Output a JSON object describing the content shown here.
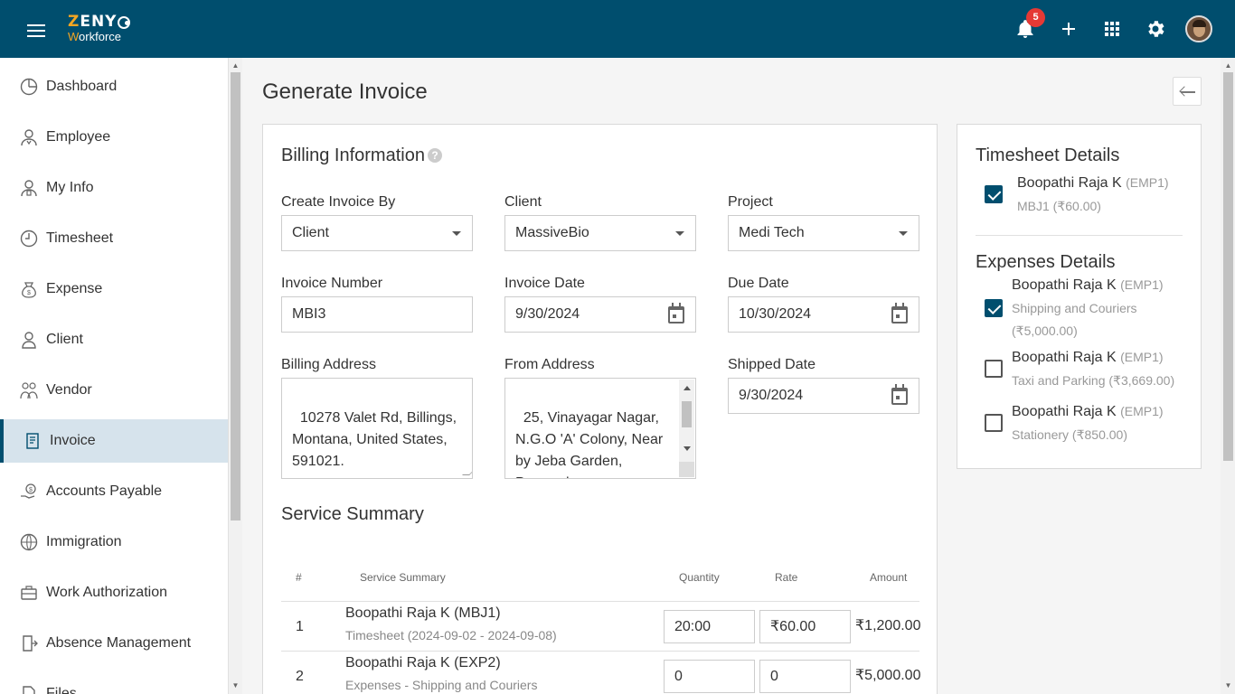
{
  "app": {
    "logo_main": "ZENY",
    "logo_sub": "Workforce"
  },
  "header": {
    "notification_count": "5"
  },
  "sidebar": {
    "items": [
      {
        "label": "Dashboard",
        "icon": "dashboard-icon"
      },
      {
        "label": "Employee",
        "icon": "employee-icon"
      },
      {
        "label": "My Info",
        "icon": "my-info-icon"
      },
      {
        "label": "Timesheet",
        "icon": "timesheet-icon"
      },
      {
        "label": "Expense",
        "icon": "expense-icon"
      },
      {
        "label": "Client",
        "icon": "client-icon"
      },
      {
        "label": "Vendor",
        "icon": "vendor-icon"
      },
      {
        "label": "Invoice",
        "icon": "invoice-icon",
        "active": true
      },
      {
        "label": "Accounts Payable",
        "icon": "accounts-payable-icon"
      },
      {
        "label": "Immigration",
        "icon": "immigration-icon"
      },
      {
        "label": "Work Authorization",
        "icon": "work-authorization-icon"
      },
      {
        "label": "Absence Management",
        "icon": "absence-management-icon"
      },
      {
        "label": "Files",
        "icon": "files-icon"
      }
    ]
  },
  "page": {
    "title": "Generate Invoice"
  },
  "billing": {
    "title": "Billing Information",
    "create_by_label": "Create Invoice By",
    "create_by_value": "Client",
    "client_label": "Client",
    "client_value": "MassiveBio",
    "project_label": "Project",
    "project_value": "Medi Tech",
    "invoice_number_label": "Invoice Number",
    "invoice_number_value": "MBI3",
    "invoice_date_label": "Invoice Date",
    "invoice_date_value": "9/30/2024",
    "due_date_label": "Due Date",
    "due_date_value": "10/30/2024",
    "billing_address_label": "Billing Address",
    "billing_address_value": "10278 Valet Rd, Billings,\nMontana, United States,\n591021.",
    "from_address_label": "From Address",
    "from_address_value": "25, Vinayagar Nagar,\nN.G.O 'A' Colony, Near\nby Jeba Garden,\nPerumalpuram,",
    "shipped_date_label": "Shipped Date",
    "shipped_date_value": "9/30/2024"
  },
  "service": {
    "title": "Service Summary",
    "headers": {
      "num": "#",
      "summary": "Service Summary",
      "quantity": "Quantity",
      "rate": "Rate",
      "amount": "Amount"
    },
    "rows": [
      {
        "num": "1",
        "name": "Boopathi Raja K (MBJ1)",
        "sub": "Timesheet (2024-09-02 - 2024-09-08)",
        "quantity": "20:00",
        "rate": "₹60.00",
        "amount": "₹1,200.00"
      },
      {
        "num": "2",
        "name": "Boopathi Raja K (EXP2)",
        "sub": "Expenses - Shipping and Couriers",
        "quantity": "0",
        "rate": "0",
        "amount": "₹5,000.00"
      }
    ]
  },
  "timesheet_details": {
    "title": "Timesheet Details",
    "items": [
      {
        "name": "Boopathi Raja K",
        "code": "(EMP1)",
        "sub": "MBJ1 (₹60.00)",
        "checked": true
      }
    ]
  },
  "expenses_details": {
    "title": "Expenses Details",
    "items": [
      {
        "name": "Boopathi Raja K",
        "code": "(EMP1)",
        "sub1": "Shipping and Couriers",
        "sub2": "(₹5,000.00)",
        "checked": true
      },
      {
        "name": "Boopathi Raja K",
        "code": "(EMP1)",
        "sub1": "Taxi and Parking (₹3,669.00)",
        "checked": false
      },
      {
        "name": "Boopathi Raja K",
        "code": "(EMP1)",
        "sub1": "Stationery (₹850.00)",
        "checked": false
      }
    ]
  },
  "colors": {
    "brand": "#004e6e",
    "accent": "#f5a623",
    "badge": "#e53935"
  }
}
